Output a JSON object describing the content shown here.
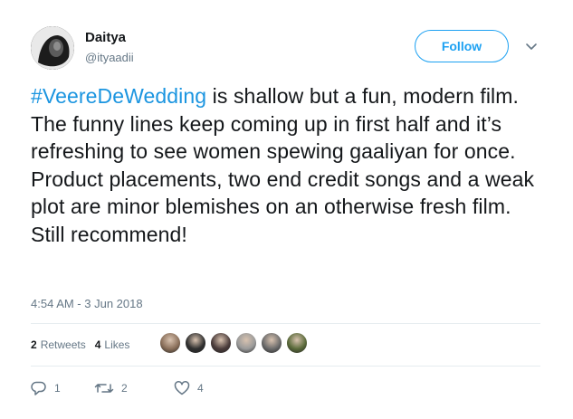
{
  "user": {
    "name": "Daitya",
    "handle": "@ityaadii"
  },
  "follow_button": {
    "label": "Follow"
  },
  "tweet": {
    "hashtag": "#VeereDeWedding",
    "body": " is shallow but a fun, modern film. The funny lines keep coming up in first half and it’s refreshing to see women spewing gaaliyan for once. Product placements, two end credit songs and a weak plot are minor blemishes on an otherwise fresh film. Still recommend!",
    "timestamp": "4:54 AM - 3 Jun 2018"
  },
  "stats": {
    "retweets_count": "2",
    "retweets_label": "Retweets",
    "likes_count": "4",
    "likes_label": "Likes"
  },
  "likers": [
    {
      "color": "#8a6f5a"
    },
    {
      "color": "#2f2f2f"
    },
    {
      "color": "#4a3b3a"
    },
    {
      "color": "#9a9a9a"
    },
    {
      "color": "#6b6b6b"
    },
    {
      "color": "#5a6a3a"
    }
  ],
  "actions": {
    "reply_count": "1",
    "retweet_count": "2",
    "like_count": "4"
  },
  "colors": {
    "accent": "#1da1f2",
    "hashtag": "#1b95e0",
    "muted": "#657786"
  },
  "icons": [
    "caret-down-icon",
    "reply-icon",
    "retweet-icon",
    "heart-icon"
  ]
}
